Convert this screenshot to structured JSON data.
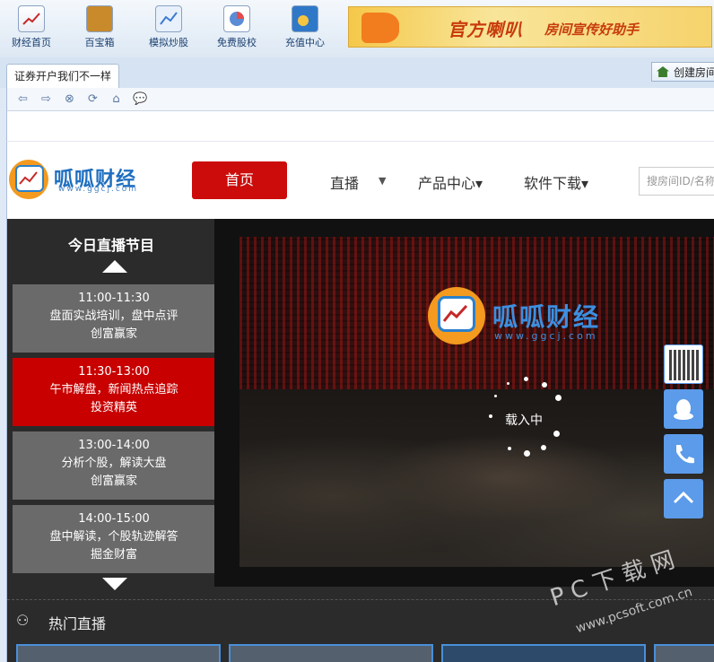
{
  "toolbar": {
    "items": [
      {
        "label": "财经首页",
        "icon": "finance-home-icon",
        "color": "#c62828"
      },
      {
        "label": "百宝箱",
        "icon": "treasure-box-icon",
        "color": "#c88a2a"
      },
      {
        "label": "模拟炒股",
        "icon": "stock-sim-icon",
        "color": "#3b7bd4"
      },
      {
        "label": "免费股校",
        "icon": "stock-school-icon",
        "color": "#5b8cd6"
      },
      {
        "label": "充值中心",
        "icon": "recharge-icon",
        "color": "#2f78c8"
      }
    ],
    "banner": {
      "main": "官方喇叭",
      "sub": "房间宣传好助手"
    }
  },
  "tabs": {
    "active": "证券开户我们不一样",
    "create_room": "创建房间"
  },
  "site": {
    "logo_text": "呱呱财经",
    "logo_url": "www.ggcj.com",
    "nav": {
      "home": "首页",
      "live": "直播",
      "live_arrow": "▼",
      "products": "产品中心▾",
      "download": "软件下载▾"
    },
    "search_placeholder": "搜房间ID/名称"
  },
  "schedule": {
    "title": "今日直播节目",
    "programs": [
      {
        "time": "11:00-11:30",
        "topic": "盘面实战培训，盘中点评",
        "host": "创富赢家",
        "active": false
      },
      {
        "time": "11:30-13:00",
        "topic": "午市解盘，新闻热点追踪",
        "host": "投资精英",
        "active": true
      },
      {
        "time": "13:00-14:00",
        "topic": "分析个股，解读大盘",
        "host": "创富赢家",
        "active": false
      },
      {
        "time": "14:00-15:00",
        "topic": "盘中解读，个股轨迹解答",
        "host": "掘金财富",
        "active": false
      }
    ]
  },
  "player": {
    "logo_text": "呱呱财经",
    "logo_url": "www.ggcj.com",
    "loading": "载入中"
  },
  "hot": {
    "title": "热门直播"
  },
  "watermark": {
    "main": "PC下载网",
    "sub": "www.pcsoft.com.cn"
  },
  "colors": {
    "accent_red": "#cc0b0b",
    "side_blue": "#5b9bea"
  }
}
